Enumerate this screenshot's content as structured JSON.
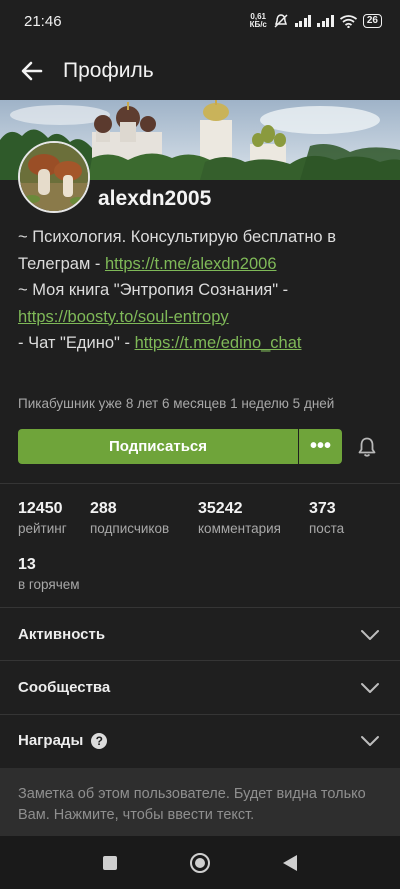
{
  "status": {
    "time": "21:46",
    "net_speed_value": "0,61",
    "net_speed_unit": "КБ/с",
    "battery": "26"
  },
  "header": {
    "title": "Профиль",
    "back_icon": "arrow-left-icon"
  },
  "profile": {
    "username": "alexdn2005",
    "bio": [
      {
        "text": "~ Психология. Консультирую бесплатно в Телеграм - ",
        "link": "https://t.me/alexdn2006"
      },
      {
        "text": "~ Моя книга \"Энтропия Сознания\" - ",
        "link": "https://boosty.to/soul-entropy"
      },
      {
        "text": "- Чат \"Едино\" - ",
        "link": "https://t.me/edino_chat"
      }
    ],
    "tenure": "Пикабушник уже 8 лет 6 месяцев 1 неделю 5 дней",
    "subscribe_label": "Подписаться",
    "more_label": "•••"
  },
  "stats": [
    {
      "value": "12450",
      "label": "рейтинг"
    },
    {
      "value": "288",
      "label": "подписчиков"
    },
    {
      "value": "35242",
      "label": "комментария"
    },
    {
      "value": "373",
      "label": "поста"
    },
    {
      "value": "13",
      "label": "в горячем"
    }
  ],
  "sections": [
    {
      "label": "Активность"
    },
    {
      "label": "Сообщества"
    },
    {
      "label": "Награды",
      "help": "?"
    }
  ],
  "note": {
    "placeholder": "Заметка об этом пользователе. Будет видна только Вам. Нажмите, чтобы ввести текст."
  },
  "colors": {
    "accent": "#6fa43a",
    "link": "#7fb958",
    "background": "#1f1f1f"
  }
}
